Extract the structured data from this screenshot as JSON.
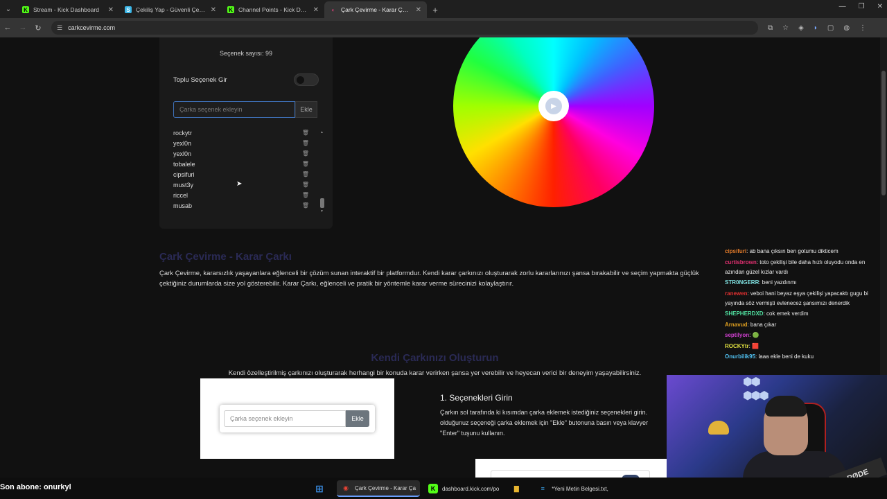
{
  "browser": {
    "tabs": [
      {
        "title": "Stream - Kick Dashboard",
        "icon": "K",
        "color": "#53fc18"
      },
      {
        "title": "Çekiliş Yap - Güvenli Çekiliş - K",
        "icon": "S",
        "color": "#3bb7e8"
      },
      {
        "title": "Channel Points - Kick Dashboard",
        "icon": "K",
        "color": "#53fc18"
      },
      {
        "title": "Çark Çevirme - Karar Çarkı",
        "icon": "◐",
        "color": "#e0407a"
      }
    ],
    "url": "carkcevirme.com"
  },
  "panel": {
    "option_count": "Seçenek sayısı: 99",
    "bulk_label": "Toplu Seçenek Gir",
    "input_placeholder": "Çarka seçenek ekleyin",
    "add_label": "Ekle",
    "items": [
      "rockytr",
      "yexl0n",
      "yexl0n",
      "tobalele",
      "cipsifuri",
      "must3y",
      "riccel",
      "musab"
    ]
  },
  "wheel": {
    "colors": [
      "#00ffff",
      "#4060ff",
      "#ff00e0",
      "#ff2000",
      "#ffe000",
      "#20ff40"
    ]
  },
  "content": {
    "heading1": "Çark Çevirme - Karar Çarkı",
    "paragraph1": "Çark Çevirme, kararsızlık yaşayanlara eğlenceli bir çözüm sunan interaktif bir platformdur. Kendi karar çarkınızı oluşturarak zorlu kararlarınızı şansa bırakabilir ve seçim yapmakta güçlük çektiğiniz durumlarda size yol gösterebilir. Karar Çarkı, eğlenceli ve pratik bir yöntemle karar verme sürecinizi kolaylaştırır.",
    "heading2": "Kendi Çarkınızı Oluşturun",
    "subtitle": "Kendi özelleştirilmiş çarkınızı oluşturarak herhangi bir konuda karar verirken şansa yer verebilir ve heyecan verici bir deneyim yaşayabilirsiniz.",
    "demo_placeholder": "Çarka seçenek ekleyin",
    "demo_add": "Ekle",
    "step1_title": "1. Seçenekleri Girin",
    "step1_text": "Çarkın sol tarafında ki kısımdan çarka eklemek istediğiniz seçenekleri girin. olduğunuz seçeneği çarka eklemek için \"Ekle\" butonuna basın veya klavyer \"Enter\" tuşunu kullanın."
  },
  "chat": [
    {
      "user": "cipsifuri",
      "color": "#e07a2a",
      "text": ": ab bana çıksın ben gotumu dikticem"
    },
    {
      "user": "curtisbrown",
      "color": "#e03070",
      "text": ": toto çekilişi bile daha hızlı oluyodu onda en azından güzel kızlar vardı"
    },
    {
      "user": "STR0NGERR",
      "color": "#7fe0e0",
      "text": ": beni yazdınmı"
    },
    {
      "user": "ranewen",
      "color": "#e03030",
      "text": ": veboi hani beyaz eşya çekilişi yapacaktı gugu bi yayında söz vermişti evlenecez şansımızı denerdik"
    },
    {
      "user": "SHEPHERDXD",
      "color": "#50e0a0",
      "text": ": cok emek verdim"
    },
    {
      "user": "Arnavud",
      "color": "#e0a020",
      "text": ": bana çıkar"
    },
    {
      "user": "septilyon",
      "color": "#d040d0",
      "text": ": 🟢"
    },
    {
      "user": "ROCKYtr",
      "color": "#e0e040",
      "text": ": 🟥"
    },
    {
      "user": "Onurbilik95",
      "color": "#50c0f0",
      "text": ": laaa ekle beni de kuku"
    }
  ],
  "webcam": {
    "mic_brand": "RØDE"
  },
  "bottom": {
    "last_sub": "Son abone: onurkyl",
    "taskbar": [
      {
        "label": "",
        "icon": "⊞",
        "color": "#3a8ee6"
      },
      {
        "label": "Çark Çevirme - Karar Ça",
        "icon": "◉",
        "color": "#ea4335"
      },
      {
        "label": "dashboard.kick.com/po",
        "icon": "K",
        "color": "#53fc18"
      },
      {
        "label": "",
        "icon": "▇",
        "color": "#e8b530"
      },
      {
        "label": "*Yeni Metin Belgesi.txt, ",
        "icon": "≡",
        "color": "#3aa0e6"
      }
    ]
  }
}
